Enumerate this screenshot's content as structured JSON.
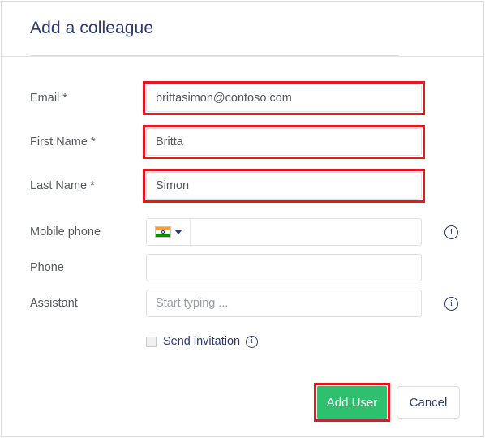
{
  "dialog": {
    "title": "Add a colleague"
  },
  "form": {
    "fields": [
      {
        "label": "Email *",
        "value": "brittasimon@contoso.com",
        "placeholder": "",
        "highlighted": true
      },
      {
        "label": "First Name *",
        "value": "Britta",
        "placeholder": "",
        "highlighted": true
      },
      {
        "label": "Last Name *",
        "value": "Simon",
        "placeholder": "",
        "highlighted": true
      },
      {
        "label": "Mobile phone",
        "value": "",
        "placeholder": "",
        "highlighted": false,
        "country_flag": "india-flag-icon"
      },
      {
        "label": "Phone",
        "value": "",
        "placeholder": "",
        "highlighted": false
      },
      {
        "label": "Assistant",
        "value": "",
        "placeholder": "Start typing ...",
        "highlighted": false
      }
    ],
    "checkbox": {
      "label": "Send invitation",
      "checked": false,
      "info_icon": "info-icon",
      "info_glyph": "i"
    },
    "info_glyph": "i"
  },
  "footer": {
    "primary_label": "Add User",
    "secondary_label": "Cancel",
    "primary_highlighted": true
  },
  "colors": {
    "title": "#2e3a6e",
    "label": "#555a60",
    "annotation": "#e8161f",
    "primary_button": "#2ec06d",
    "secondary_text": "#2e3a6e",
    "field_border": "#dfe1e3",
    "placeholder": "#9a9ea3"
  }
}
